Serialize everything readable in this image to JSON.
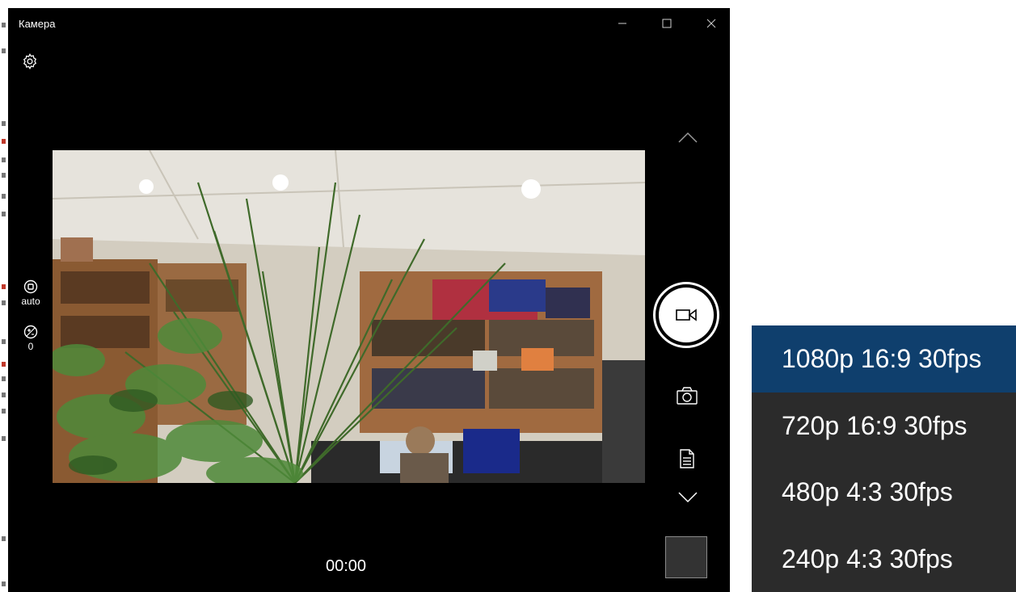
{
  "window": {
    "title": "Камера",
    "controls": [
      "minimize-icon",
      "maximize-icon",
      "close-icon"
    ]
  },
  "toolbar": {
    "settings_icon": "gear-icon"
  },
  "left_controls": {
    "mode_label": "auto",
    "exposure_value": "0"
  },
  "right_controls": {
    "record_icon": "video-camera-icon",
    "photo_icon": "camera-icon",
    "document_icon": "document-icon"
  },
  "status": {
    "timer": "00:00"
  },
  "resolution_menu": {
    "selected_index": 0,
    "items": [
      {
        "label": "1080p 16:9 30fps"
      },
      {
        "label": "720p 16:9 30fps"
      },
      {
        "label": "480p 4:3 30fps"
      },
      {
        "label": "240p 4:3 30fps"
      }
    ]
  },
  "colors": {
    "window_bg": "#000000",
    "selected_bg": "#0f3f6d",
    "menu_bg": "#2b2b2b",
    "thumbnail_bg": "#333333"
  }
}
